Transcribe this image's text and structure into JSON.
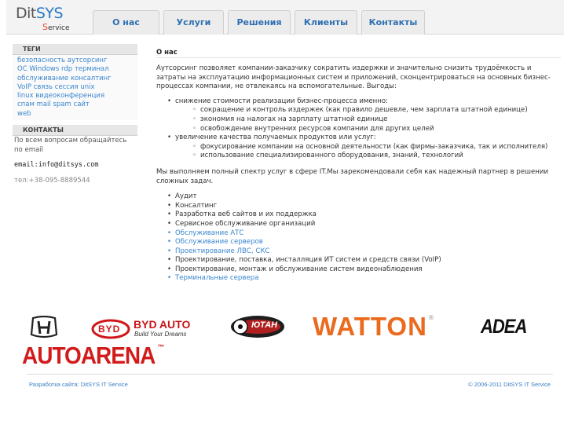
{
  "header": {
    "logo": {
      "main_dit": "Dit",
      "main_sys": "SYS",
      "sub_s": "S",
      "sub_rest": "ervice"
    },
    "tabs": [
      "О нас",
      "Услуги",
      "Решения",
      "Клиенты",
      "Контакты"
    ]
  },
  "sidebar": {
    "tags_heading": "ТЕГИ",
    "tags": [
      "безопасность",
      "аутсорсинг",
      "OC",
      "Windows",
      "rdp",
      "терминал",
      "обслуживание",
      "консалтинг",
      "VoIP",
      "связь",
      "сессия",
      "unix",
      "linux",
      "видеоконференция",
      "спам",
      "mail",
      "spam",
      "сайт",
      "web"
    ],
    "contacts_heading": "КОНТАКТЫ",
    "contacts_text": "По всем вопросам обращайтесь по email",
    "email": "email:info@ditsys.com",
    "phone": "тел:+38-095-8889544"
  },
  "content": {
    "title": "О нас",
    "intro": "Аутсорсинг позволяет компании-заказчику сократить издержки и значительно снизить трудоёмкость и затраты на эксплуатацию информационных систем и приложений, сконцентрироваться на основных бизнес-процессах компании, не отвлекаясь на вспомогательные. Выгоды:",
    "benefits": [
      {
        "text": "снижение стоимости реализации бизнес-процесса именно:",
        "sub": [
          "сокращение и контроль издержек (как правило дешевле, чем зарплата штатной единице)",
          "экономия на налогах на зарплату штатной единице",
          "освобождение внутренних ресурсов компании для других целей"
        ]
      },
      {
        "text": "увеличение качества получаемых продуктов или услуг:",
        "sub": [
          "фокусирование компании на основной деятельности (как фирмы-заказчика, так и исполнителя)",
          "использование специализированного оборудования, знаний, технологий"
        ]
      }
    ],
    "services_intro": "Мы выполняем полный спектр услуг в сфере  IT.Мы зарекомендовали себя как надежный партнер в решении сложных задач.",
    "services": [
      {
        "text": "Аудит",
        "link": false
      },
      {
        "text": "Консалтинг",
        "link": false
      },
      {
        "text": "Разработка веб сайтов и их поддержка",
        "link": false
      },
      {
        "text": "Сервисное обслуживание организаций",
        "link": false
      },
      {
        "text": "Обслуживание АТС",
        "link": true
      },
      {
        "text": "Обслуживание серверов",
        "link": true
      },
      {
        "text": "Проектирование ЛВС, СКС",
        "link": true
      },
      {
        "text": "Проектирование, поставка, инсталляция ИТ систем и средств связи (VoIP)",
        "link": false
      },
      {
        "text": "Проектирование, монтаж и обслуживание систем видеонаблюдения",
        "link": false
      },
      {
        "text": "Терминальные сервера",
        "link": true
      }
    ]
  },
  "clients": {
    "byd": "BYD AUTO",
    "byd_tag": "Build Your Dreams",
    "byd_badge": "BYD",
    "utah": "ЮТАН",
    "watton": "WATTON",
    "adea": "ADEA",
    "autoarena": "AUTOARENA"
  },
  "footer": {
    "left": "Разработка сайта: DitSYS IT Service",
    "right": "© 2006-2011 DitSYS IT Service"
  },
  "colors": {
    "link": "#3a86cf",
    "tab_text": "#2e6fb1",
    "watton_orange": "#ea6a1e",
    "autoarena_red": "#d21b1b"
  }
}
